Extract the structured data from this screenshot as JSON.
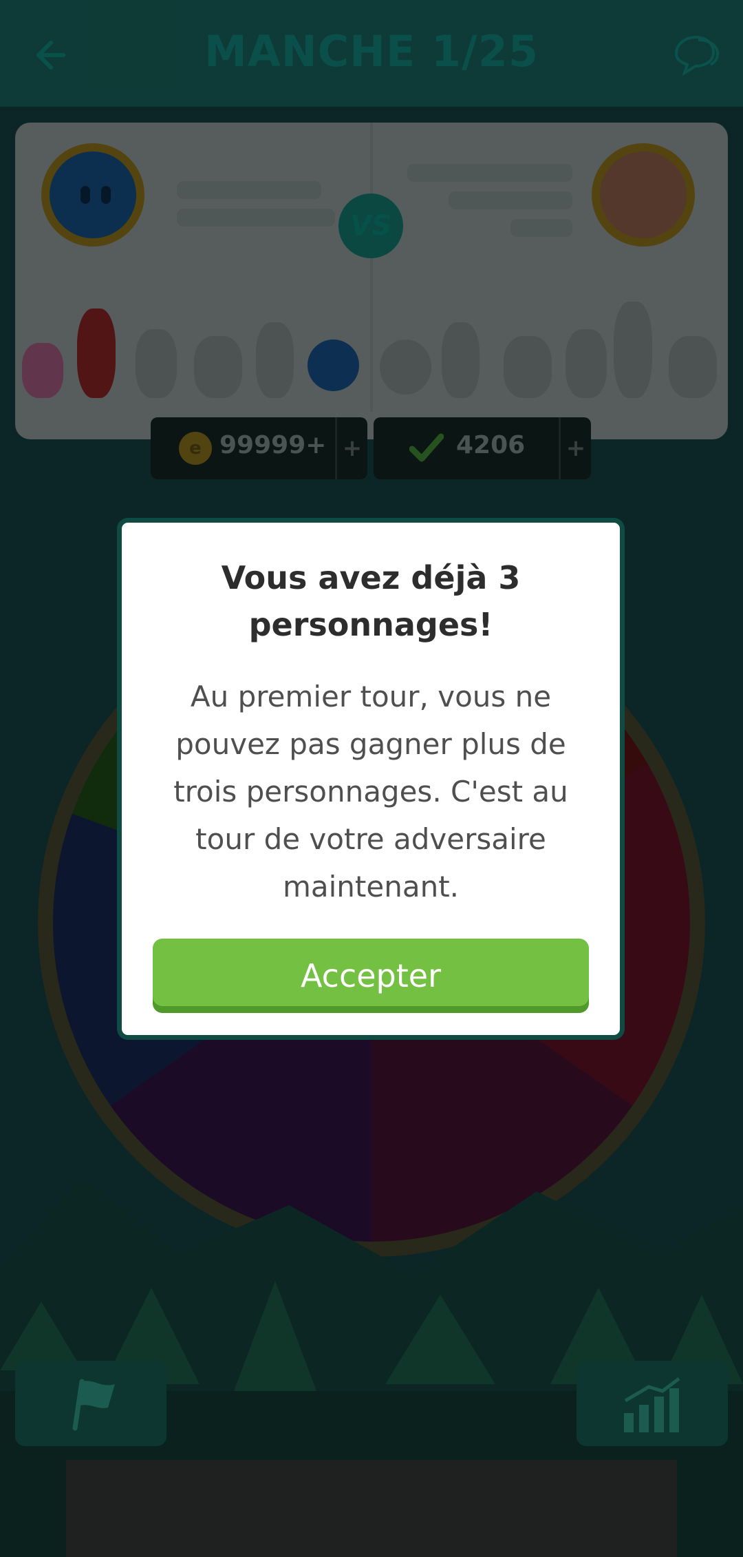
{
  "header": {
    "title": "MANCHE 1/25",
    "back_icon": "arrow-left-icon",
    "chat_icon": "chat-bubbles-icon"
  },
  "counters": {
    "coins": {
      "value": "99999+",
      "plus": "+"
    },
    "answers": {
      "value": "4206",
      "plus": "+"
    }
  },
  "versus_label": "VS",
  "dialog": {
    "title": "Vous avez déjà 3 personnages!",
    "message": "Au premier tour, vous ne pouvez pas gagner plus de trois personnages. C'est au tour de votre adversaire maintenant.",
    "accept_label": "Accepter"
  },
  "colors": {
    "accent_green": "#74c043",
    "dialog_border": "#0f4a43",
    "header_bg": "#10403c"
  }
}
